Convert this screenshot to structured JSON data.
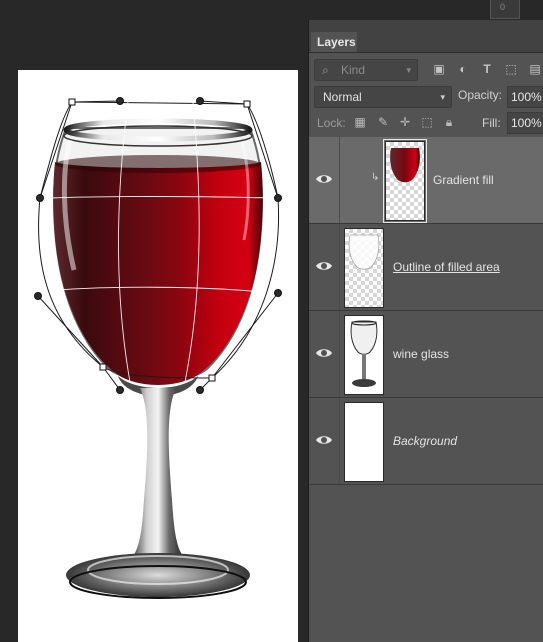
{
  "top_tab": {
    "label": "0"
  },
  "panel": {
    "tab_label": "Layers",
    "filter": {
      "icon": "search-icon",
      "placeholder": "Kind"
    },
    "filter_icons": [
      "image-filter-icon",
      "adjustment-filter-icon",
      "type-filter-icon",
      "shape-filter-icon",
      "smart-object-filter-icon"
    ],
    "blend_mode": "Normal",
    "opacity_label": "Opacity:",
    "opacity_value": "100%",
    "lock_label": "Lock:",
    "lock_icons": [
      "lock-transparent-icon",
      "lock-image-icon",
      "lock-position-icon",
      "lock-artboard-icon",
      "lock-all-icon"
    ],
    "fill_label": "Fill:",
    "fill_value": "100%"
  },
  "layers": [
    {
      "name": "Gradient fill",
      "visible": true,
      "selected": true,
      "clipped": true,
      "style": "normal"
    },
    {
      "name": "Outline of filled area",
      "visible": true,
      "selected": false,
      "clipped": false,
      "style": "underline"
    },
    {
      "name": "wine glass",
      "visible": true,
      "selected": false,
      "clipped": false,
      "style": "normal"
    },
    {
      "name": "Background",
      "visible": true,
      "selected": false,
      "clipped": false,
      "style": "italic"
    }
  ],
  "colors": {
    "wine_dark": "#3a0a0e",
    "wine_mid": "#9b0610",
    "wine_bright": "#d40012",
    "panel_bg": "#535353",
    "selected_row": "#6a6a6a"
  }
}
